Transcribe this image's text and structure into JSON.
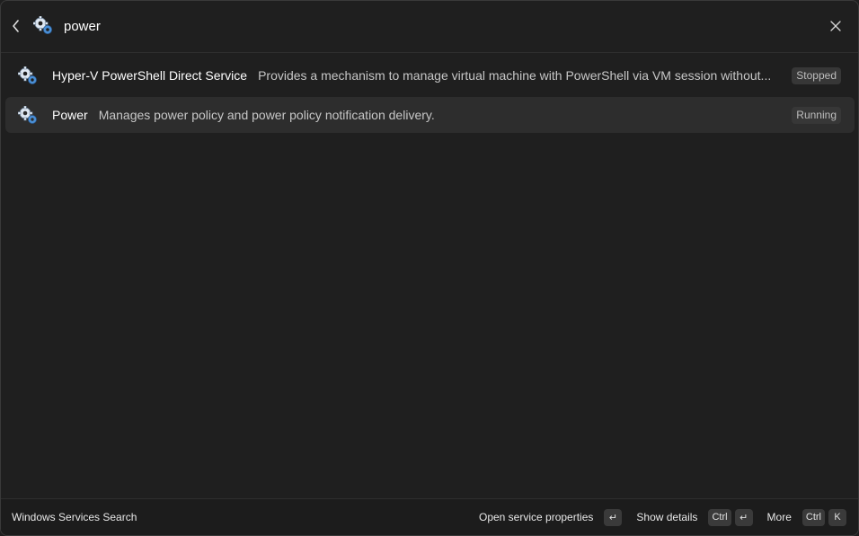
{
  "header": {
    "search_value": "power",
    "back_icon": "chevron-left-icon",
    "app_icon": "services-gears-icon",
    "close_icon": "close-icon"
  },
  "results": [
    {
      "name": "Hyper-V PowerShell Direct Service",
      "description": "Provides a mechanism to manage virtual machine with PowerShell via VM session without...",
      "status": "Stopped",
      "icon": "service-gear-icon",
      "selected": false
    },
    {
      "name": "Power",
      "description": "Manages power policy and power policy notification delivery.",
      "status": "Running",
      "icon": "service-gear-icon",
      "selected": true
    }
  ],
  "footer": {
    "title": "Windows Services Search",
    "actions": [
      {
        "label": "Open service properties",
        "keys": [
          "↵"
        ]
      },
      {
        "label": "Show details",
        "keys": [
          "Ctrl",
          "↵"
        ]
      },
      {
        "label": "More",
        "keys": [
          "Ctrl",
          "K"
        ]
      }
    ]
  },
  "colors": {
    "background": "#1f1f1f",
    "selected_row": "#2d2d2d",
    "badge_bg": "#373737",
    "gear_blue": "#4a8fd6"
  }
}
